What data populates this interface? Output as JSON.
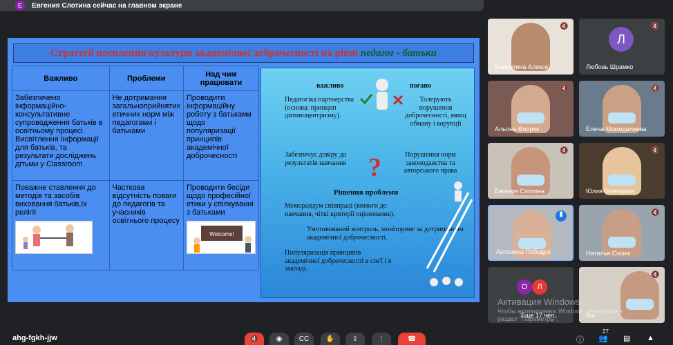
{
  "topbar": {
    "avatar_letter": "Е",
    "text": "Евгения Слотина сейчас на главном экране"
  },
  "slide": {
    "title_red": "Стратегії посилення культури академічної доброчесності на рівні",
    "title_green": "педагог - батьки",
    "table": {
      "headers": [
        "Важливо",
        "Проблеми",
        "Над чим працювати"
      ],
      "rows": [
        [
          "Забезпечено інформаційно-консультативне супроводження батьків в освітньому процесі. Висвітлення інформації для батьків, та результати досліджень дітьми у Classroom",
          "Не дотримання загальноприйнятих етичних норм між педагогами і батьками",
          "Проводити інформаційну роботу з батьками щодо популяризації принципів академічної доброчесності"
        ],
        [
          "Поважне ставлення до методів та засобів виховання батьків,їх релігії",
          "Часткова відсутність поваги до педагогів та учасників освітнього процесу",
          "Проводити бесіди щодо професійної етики у спілкуванні з батьками"
        ]
      ]
    },
    "right": {
      "important": "важливо",
      "bad": "погано",
      "p1_left": "Педагогіка партнерства (основа: принцип дитиноцентризму).",
      "p1_right": "Толерують порушення доброчесності, явищ обману і корупції",
      "p2_left": "Забезпечує довіру до результатів навчання",
      "p2_right": "Порушення норм законодавства та авторського права",
      "solution_title": "Рішення проблеми",
      "s1": "Меморандум співпраці (вимоги до навчання, чіткі критерії оцінювання).",
      "s2": "Умотивований контроль, моніторинг за дотриманням академічної доброчесності.",
      "s3": "Популяризація принципів академічної доброчесності в сім'ї і в закладі."
    },
    "welcome_text": "Welcome!"
  },
  "participants": [
    {
      "name": "Валентина Алексе...",
      "type": "video",
      "muted": true
    },
    {
      "name": "Любовь Шрамко",
      "type": "avatar",
      "letter": "Л",
      "color": "#7e57c2",
      "muted": true
    },
    {
      "name": "Альона Флоряк",
      "type": "video",
      "muted": true
    },
    {
      "name": "Елена Мамедалиева",
      "type": "video",
      "muted": true
    },
    {
      "name": "Евгения Слотина",
      "type": "video",
      "muted": true
    },
    {
      "name": "Юлия Безверхая",
      "type": "video",
      "muted": true
    },
    {
      "name": "Антонина Победря",
      "type": "video",
      "speaking": true
    },
    {
      "name": "Наталья Сосна",
      "type": "video",
      "muted": true
    },
    {
      "name": "Еще 17 чел.",
      "type": "more",
      "letters": [
        "О",
        "Л"
      ]
    },
    {
      "name": "Вы",
      "type": "video",
      "muted": true
    }
  ],
  "watermark": {
    "title": "Активация Windows",
    "line1": "Чтобы активировать Windows, перейдите в",
    "line2": "раздел \"Параметры\"."
  },
  "bottom": {
    "meeting_code": "ahg-fgkh-jjw",
    "people_count": "27"
  },
  "colors": {
    "end_call": "#ea4335",
    "speaking_border": "#8ab4f8"
  }
}
